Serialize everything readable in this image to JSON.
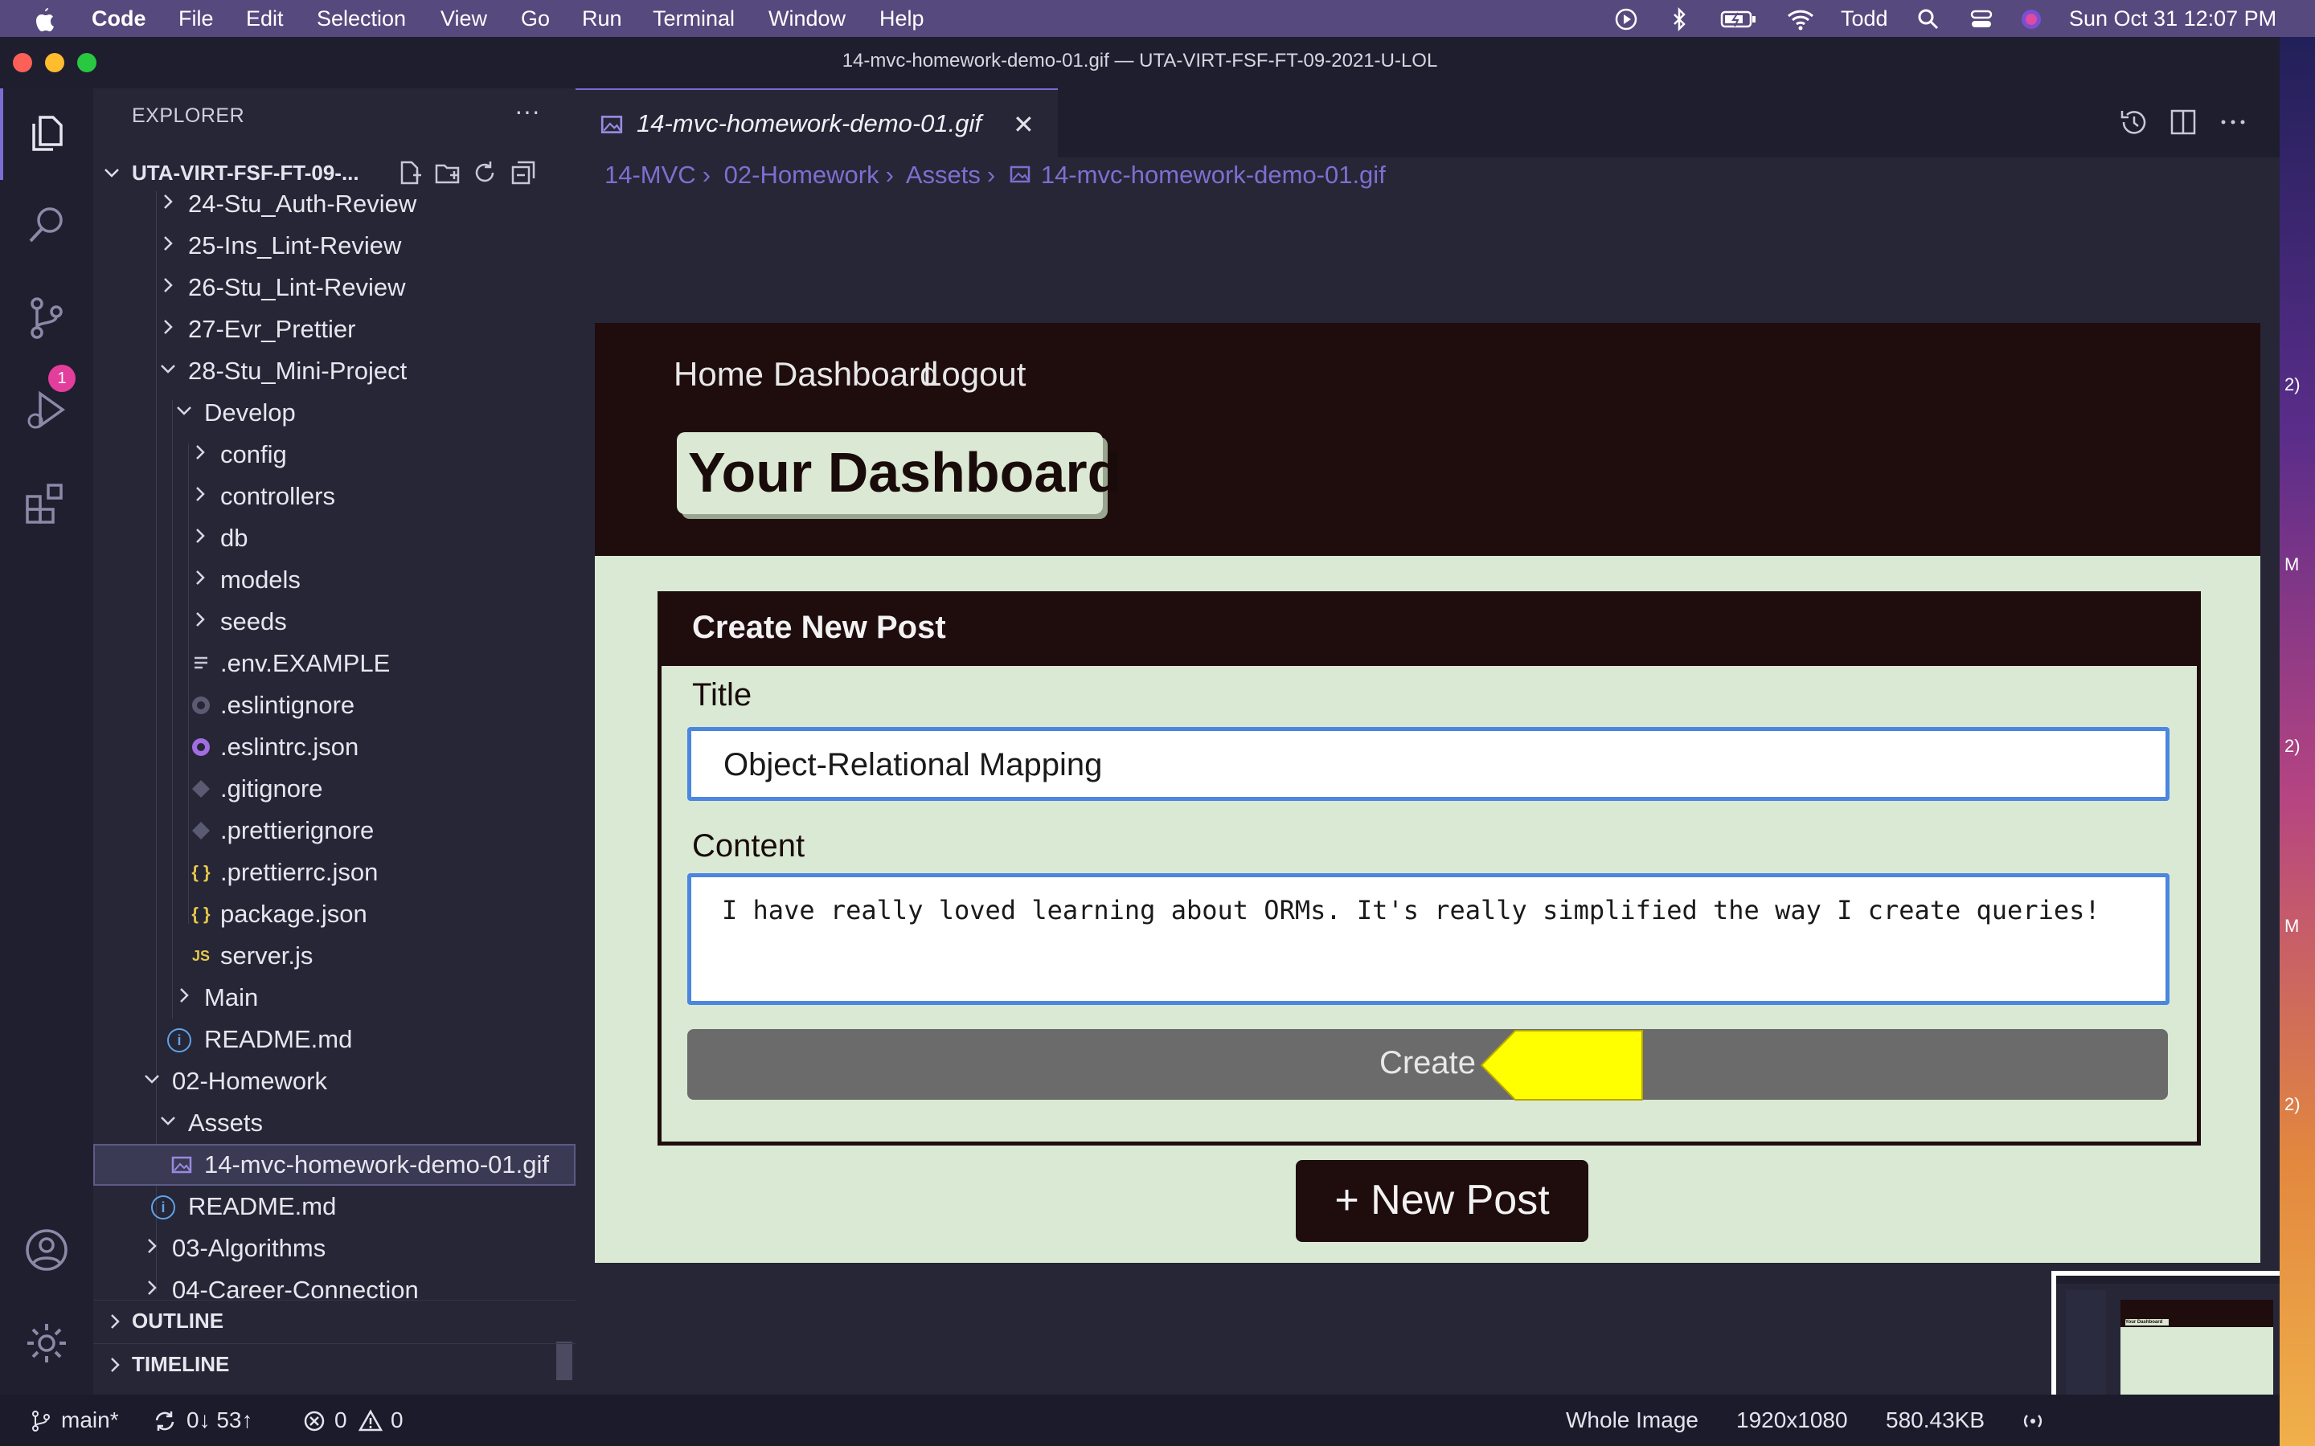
{
  "menubar": {
    "app_name": "Code",
    "items": [
      "File",
      "Edit",
      "Selection",
      "View",
      "Go",
      "Run",
      "Terminal",
      "Window",
      "Help"
    ],
    "user": "Todd",
    "datetime": "Sun Oct 31  12:07 PM"
  },
  "window": {
    "title": "14-mvc-homework-demo-01.gif — UTA-VIRT-FSF-FT-09-2021-U-LOL"
  },
  "activity_bar": {
    "source_control_badge": "1"
  },
  "sidebar": {
    "title": "EXPLORER",
    "more": "···",
    "root": "UTA-VIRT-FSF-FT-09-...",
    "items": [
      {
        "label": "24-Stu_Auth-Review"
      },
      {
        "label": "25-Ins_Lint-Review"
      },
      {
        "label": "26-Stu_Lint-Review"
      },
      {
        "label": "27-Evr_Prettier"
      },
      {
        "label": "28-Stu_Mini-Project"
      },
      {
        "label": "Develop"
      },
      {
        "label": "config"
      },
      {
        "label": "controllers"
      },
      {
        "label": "db"
      },
      {
        "label": "models"
      },
      {
        "label": "seeds"
      },
      {
        "label": ".env.EXAMPLE"
      },
      {
        "label": ".eslintignore"
      },
      {
        "label": ".eslintrc.json"
      },
      {
        "label": ".gitignore"
      },
      {
        "label": ".prettierignore"
      },
      {
        "label": ".prettierrc.json"
      },
      {
        "label": "package.json"
      },
      {
        "label": "server.js"
      },
      {
        "label": "Main"
      },
      {
        "label": "README.md"
      },
      {
        "label": "02-Homework"
      },
      {
        "label": "Assets"
      },
      {
        "label": "14-mvc-homework-demo-01.gif"
      },
      {
        "label": "README.md"
      },
      {
        "label": "03-Algorithms"
      },
      {
        "label": "04-Career-Connection"
      }
    ],
    "icon_glyphs": {
      "json": "{ }",
      "js": "JS",
      "info": "i"
    },
    "sections": [
      "OUTLINE",
      "TIMELINE"
    ]
  },
  "editor": {
    "tab_label": "14-mvc-homework-demo-01.gif",
    "tab_close": "✕",
    "breadcrumb": [
      "14-MVC",
      "02-Homework",
      "Assets",
      "14-mvc-homework-demo-01.gif"
    ],
    "breadcrumb_sep": "›"
  },
  "preview": {
    "nav": [
      "Home",
      "Dashboard",
      "Logout"
    ],
    "dashboard_title": "Your Dashboard",
    "card_title": "Create New Post",
    "title_label": "Title",
    "title_value": "Object-Relational Mapping",
    "content_label": "Content",
    "content_value": "I have really loved learning about ORMs. It's really simplified the way I create queries!",
    "create_label": "Create",
    "new_post_label": "+ New Post",
    "thumb_title": "Your Dashboard",
    "colors": {
      "header": "#1f0c0d",
      "background": "#d9e9d3",
      "input_border": "#4b86e0",
      "button": "#6b6b6b",
      "pointer": "#ffff00"
    }
  },
  "statusbar": {
    "branch": "main*",
    "sync": "0↓ 53↑",
    "errors": "0",
    "warnings": "0",
    "image_mode": "Whole Image",
    "dimensions": "1920x1080",
    "file_size": "580.43KB"
  },
  "wallpaper_fragments": [
    "2)",
    "M",
    "2)",
    "M",
    "2)"
  ]
}
